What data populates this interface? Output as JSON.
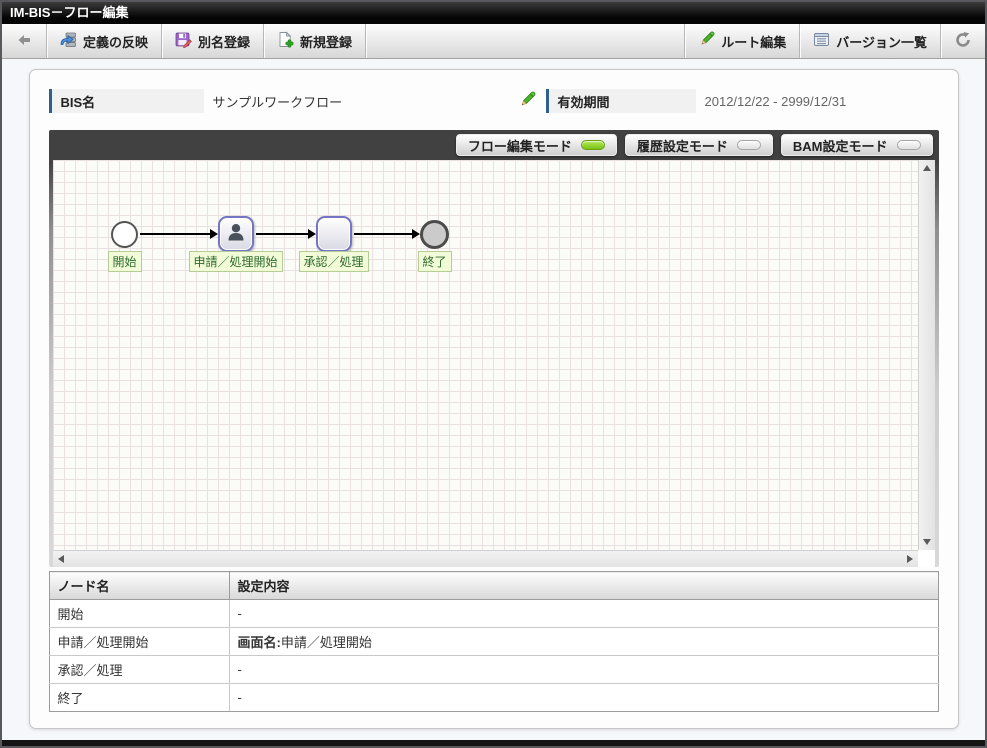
{
  "title_bar": {
    "title": "IM-BIS－フロー編集"
  },
  "toolbar": {
    "back_icon": "back-arrow-icon",
    "left_buttons": [
      {
        "label": "定義の反映",
        "icon": "apply-definition-icon"
      },
      {
        "label": "別名登録",
        "icon": "alias-register-icon"
      },
      {
        "label": "新規登録",
        "icon": "new-register-icon"
      }
    ],
    "right_buttons": [
      {
        "label": "ルート編集",
        "icon": "route-edit-pencil-icon"
      },
      {
        "label": "バージョン一覧",
        "icon": "version-list-icon"
      }
    ],
    "refresh_icon": "refresh-icon"
  },
  "info_bar": {
    "bis_name": {
      "label": "BIS名",
      "value": "サンプルワークフロー",
      "edit_icon": "edit-pencil-icon"
    },
    "valid_period": {
      "label": "有効期間",
      "value": "2012/12/22 - 2999/12/31"
    }
  },
  "mode_bar": {
    "buttons": [
      {
        "label": "フロー編集モード",
        "state": "on"
      },
      {
        "label": "履歴設定モード",
        "state": "off"
      },
      {
        "label": "BAM設定モード",
        "state": "off"
      }
    ]
  },
  "canvas": {
    "nodes": [
      {
        "type": "start-event",
        "label": "開始"
      },
      {
        "type": "user-task",
        "label": "申請／処理開始",
        "icon": "person-icon"
      },
      {
        "type": "task",
        "label": "承認／処理"
      },
      {
        "type": "end-event",
        "label": "終了"
      }
    ]
  },
  "settings_table": {
    "headers": [
      "ノード名",
      "設定内容"
    ],
    "rows": [
      {
        "node": "開始",
        "setting": "-"
      },
      {
        "node": "申請／処理開始",
        "setting_label": "画面名:",
        "setting_value": "申請／処理開始"
      },
      {
        "node": "承認／処理",
        "setting": "-"
      },
      {
        "node": "終了",
        "setting": "-"
      }
    ]
  },
  "colors": {
    "accent_blue": "#2d5f8f",
    "active_led_green": "#7cc414",
    "node_border_purple": "#7474c4",
    "flow_label_bg": "#f2fbd8",
    "flow_label_text": "#2e6b2e"
  }
}
